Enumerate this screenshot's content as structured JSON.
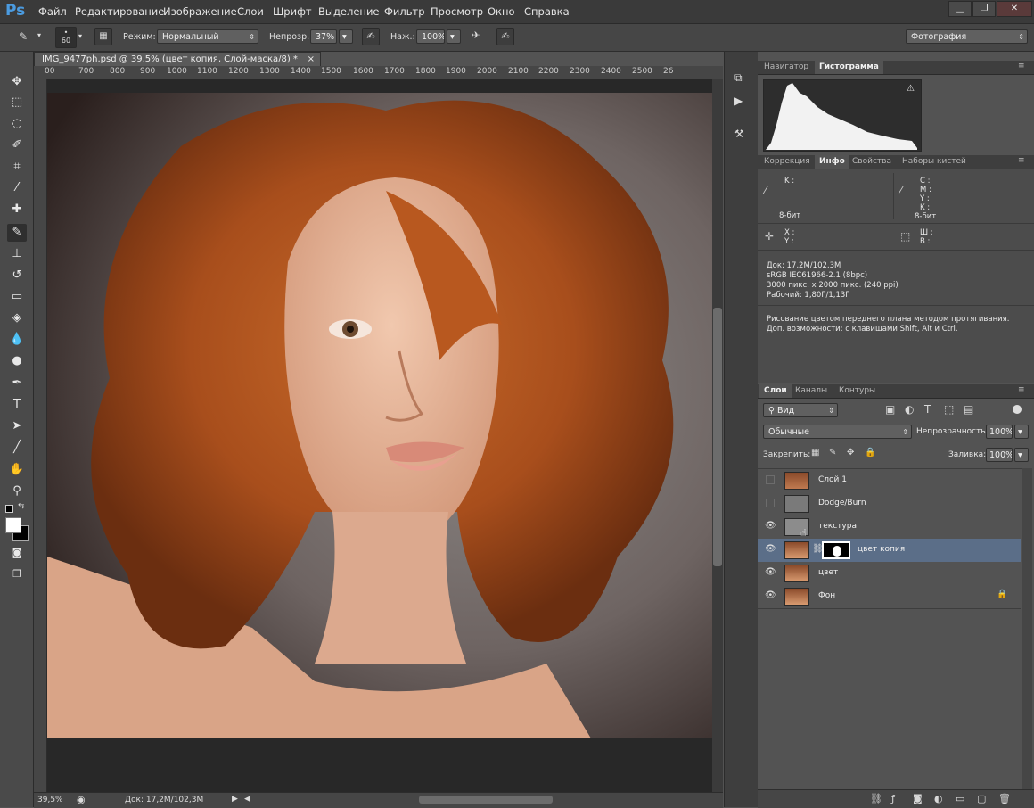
{
  "app": {
    "logo": "Ps"
  },
  "menu": [
    "Файл",
    "Редактирование",
    "Изображение",
    "Слои",
    "Шрифт",
    "Выделение",
    "Фильтр",
    "Просмотр",
    "Окно",
    "Справка"
  ],
  "window_controls": {
    "minimize": "▁",
    "restore": "❐",
    "close": "✕"
  },
  "options_bar": {
    "brush_size": "60",
    "mode_label": "Режим:",
    "mode_value": "Нормальный",
    "opacity_label": "Непрозр.:",
    "opacity_value": "37%",
    "flow_label": "Наж.:",
    "flow_value": "100%",
    "workspace": "Фотография"
  },
  "document_tab": {
    "title": "IMG_9477ph.psd @ 39,5% (цвет копия, Слой-маска/8) *",
    "close": "×"
  },
  "ruler_ticks": [
    "00",
    "700",
    "800",
    "900",
    "1000",
    "1100",
    "1200",
    "1300",
    "1400",
    "1500",
    "1600",
    "1700",
    "1800",
    "1900",
    "2000",
    "2100",
    "2200",
    "2300",
    "2400",
    "2500",
    "26"
  ],
  "status_bar": {
    "zoom": "39,5%",
    "doc": "Док: 17,2M/102,3M"
  },
  "navigator_panel": {
    "tabs": [
      "Навигатор",
      "Гистограмма"
    ],
    "active": 1
  },
  "info_panel": {
    "tabs": [
      "Коррекция",
      "Инфо",
      "Свойства",
      "Наборы кистей"
    ],
    "active": 1,
    "k_label": "K :",
    "cmyk_labels": [
      "C :",
      "M :",
      "Y :",
      "K :"
    ],
    "bit_left": "8-бит",
    "bit_right": "8-бит",
    "xy_labels": [
      "X :",
      "Y :"
    ],
    "wh_labels": [
      "Ш :",
      "В :"
    ],
    "doc_info": [
      "Док: 17,2M/102,3M",
      "sRGB IEC61966-2.1 (8bpc)",
      "3000 пикс. x 2000 пикс. (240 ppi)",
      "Рабочий: 1,80Г/1,13Г"
    ],
    "hint": "Рисование цветом переднего плана методом протягивания. Доп. возможности: с клавишами Shift, Alt и Ctrl."
  },
  "layers_panel": {
    "tabs": [
      "Слои",
      "Каналы",
      "Контуры"
    ],
    "active": 0,
    "filter_kind": "Вид",
    "blend_mode": "Обычные",
    "opacity_label": "Непрозрачность:",
    "opacity_value": "100%",
    "lock_label": "Закрепить:",
    "fill_label": "Заливка:",
    "fill_value": "100%",
    "layers": [
      {
        "name": "Слой 1",
        "visible": false
      },
      {
        "name": "Dodge/Burn",
        "visible": false
      },
      {
        "name": "текстура",
        "visible": true
      },
      {
        "name": "цвет копия",
        "visible": true,
        "selected": true,
        "has_mask": true
      },
      {
        "name": "цвет",
        "visible": true
      },
      {
        "name": "Фон",
        "visible": true,
        "locked": true
      }
    ]
  },
  "colors": {
    "accent": "#4b9be0",
    "selection": "#5b6e88",
    "panel": "#535353"
  }
}
